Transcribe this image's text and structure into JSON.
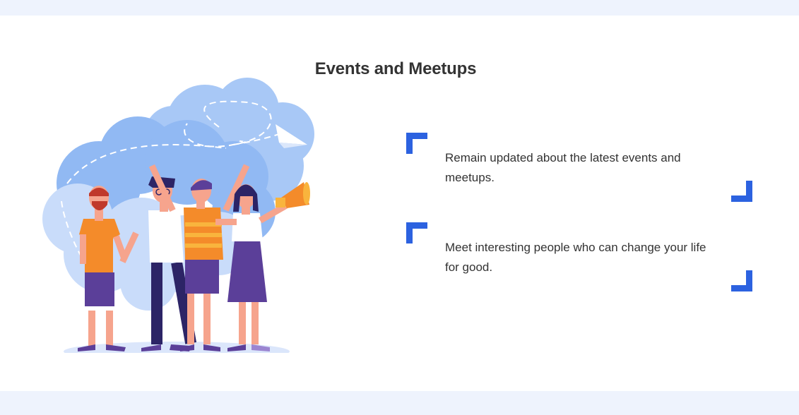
{
  "section": {
    "title": "Events and Meetups"
  },
  "features": [
    {
      "text": "Remain updated about the latest events and meetups.",
      "icon": "corner-bracket-icon"
    },
    {
      "text": "Meet interesting people who can change your life for good.",
      "icon": "corner-bracket-icon"
    }
  ],
  "colors": {
    "page_background": "#eef3fd",
    "panel_background": "#ffffff",
    "accent": "#2c62e0",
    "text": "#333333"
  }
}
